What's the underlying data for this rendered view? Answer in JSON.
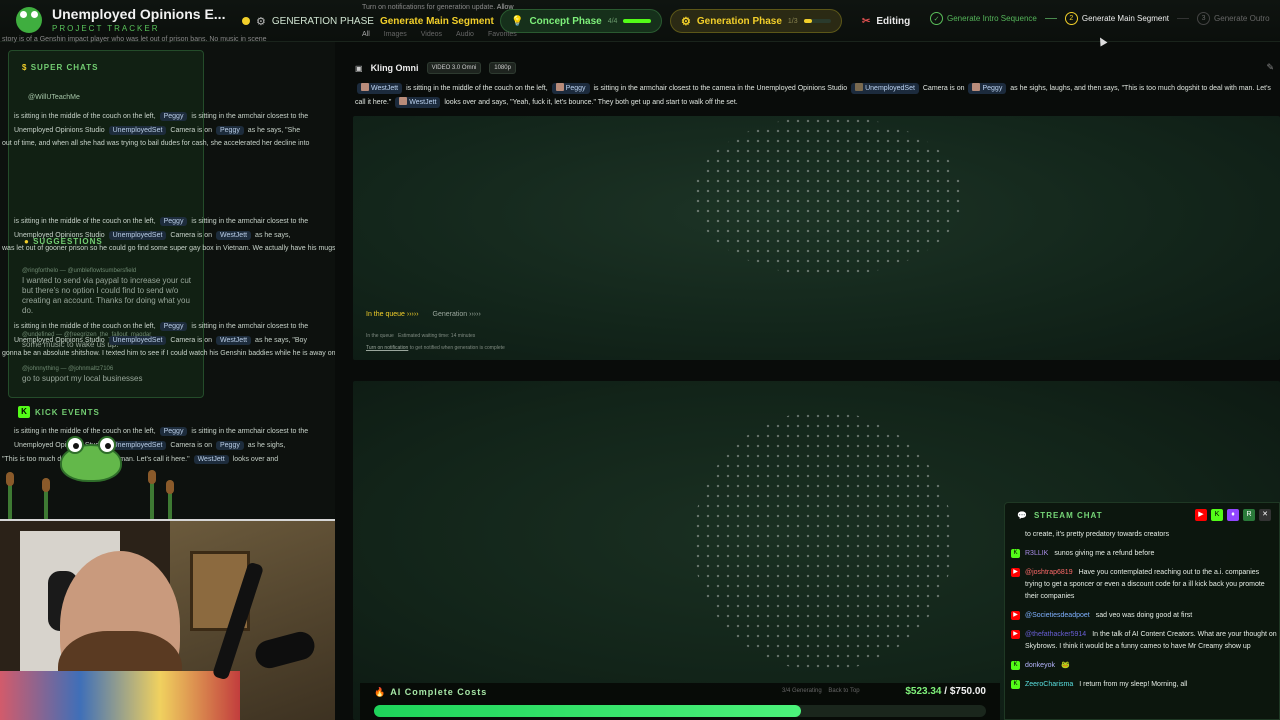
{
  "brand": {
    "title": "Unemployed Opinions E...",
    "subtitle": "PROJECT TRACKER"
  },
  "topbar": {
    "generation_label": "GENERATION PHASE",
    "generation_segment": "Generate Main Segment",
    "concept_label": "Concept Phase",
    "concept_count": "4/4",
    "concept_progress": 1.0,
    "gen_phase_label": "Generation Phase",
    "gen_phase_count": "1/3",
    "gen_phase_progress": 0.3,
    "editing_label": "Editing",
    "steps": [
      {
        "num": "✓",
        "label": "Generate Intro Sequence",
        "state": "done"
      },
      {
        "num": "2",
        "label": "Generate Main Segment",
        "state": "active"
      },
      {
        "num": "3",
        "label": "Generate Outro",
        "state": "todo"
      }
    ],
    "notification": "Turn on notifications for generation update.",
    "notification_allow": "Allow",
    "tabs": [
      "All",
      "Images",
      "Videos",
      "Audio",
      "Favorites"
    ]
  },
  "left": {
    "top_snippet": "story is of a Genshin impact player who was let out of prison bans.  No music in scene",
    "super_chats_title": "SUPER CHATS",
    "super_chat_user": "@WillUTeachMe",
    "prompt_rows": [
      {
        "a": "is sitting in the middle of the couch on the left,",
        "b": "Peggy",
        "c": "is sitting in the armchair closest to the"
      },
      {
        "a": "Unemployed Opinions Studio",
        "b": "UnemployedSet",
        "c": "Camera is on",
        "d": "Peggy",
        "e": "as he says, \"She"
      },
      {
        "a": "out of time, and when all she had was trying to bail dudes for cash, she accelerated her decline into"
      }
    ],
    "suggestions_title": "SUGGESTIONS",
    "suggestions": [
      {
        "user": "@ringforthelo — @umbleflowtsumbersfield",
        "text": "I wanted to send via paypal to increase your cut but there's no option I could find to send w/o creating an account. Thanks for doing what you do."
      },
      {
        "user": "@undefined — @freegrizen_the_fallout_magdar",
        "text": "some music to wake us up!"
      },
      {
        "user": "@johnnything — @johnmaltz7106",
        "text": "go to support my local businesses"
      }
    ],
    "prompt_rows_2": [
      {
        "a": "is sitting in the middle of the couch on the left,",
        "b": "Peggy",
        "c": "is sitting in the armchair closest to the"
      },
      {
        "a": "Unemployed Opinions Studio",
        "b": "UnemployedSet",
        "c": "Camera is on",
        "d": "WestJett",
        "e": "as he says,"
      },
      {
        "a": "was let out of gooner prison so he could go find some super gay box in Vietnam. We actually have his mugshot.\""
      }
    ],
    "prompt_rows_3": [
      {
        "a": "is sitting in the middle of the couch on the left,",
        "b": "Peggy",
        "c": "is sitting in the armchair closest to the"
      },
      {
        "a": "Unemployed Opinions Studio",
        "b": "UnemployedSet",
        "c": "Camera is on",
        "d": "WestJett",
        "e": "as he says, \"Boy"
      },
      {
        "a": "gonna be an absolute shitshow. I texted him to see if I could watch his Genshin baddies while he is away on"
      }
    ],
    "kick_events_title": "KICK EVENTS",
    "prompt_rows_4": [
      {
        "a": "is sitting in the middle of the couch on the left,",
        "b": "Peggy",
        "c": "is sitting in the armchair closest to the"
      },
      {
        "a": "Unemployed Opinions Studio",
        "b": "UnemployedSet",
        "c": "Camera is on",
        "d": "Peggy",
        "e": "as he sighs,"
      },
      {
        "a": "\"This is too much dogshit to deal with man. Let's call it here.\"",
        "b": "WestJett",
        "c": "looks over and"
      }
    ]
  },
  "job": {
    "title": "Kling Omni",
    "model_tag": "VIDEO 3.0 Omni",
    "res_tag": "1080p",
    "prompt": {
      "p1_name": "WestJett",
      "p1": "is sitting in the middle of the couch on the left,",
      "p2_name": "Peggy",
      "p2": "is sitting in the armchair closest to the camera in the Unemployed Opinions Studio",
      "p3_name": "UnemployedSet",
      "p3": "Camera is on",
      "p4_name": "Peggy",
      "p4": "as he sighs, laughs, and then says, \"This is too much dogshit to deal with man. Let's call it here.\"",
      "p5_name": "WestJett",
      "p5": "looks over and says, \"Yeah, fuck it, let's bounce.\" They both get up and start to walk off the set."
    },
    "queue_status": "In the queue",
    "generation_status": "Generation",
    "queue_line1a": "In the queue",
    "queue_line1b": "Estimated waiting time: 14 minutes",
    "queue_link": "Turn on notification",
    "queue_line2": "to get notified when generation is complete"
  },
  "chat": {
    "title": "STREAM CHAT",
    "messages": [
      {
        "platform": "youtube",
        "user": "",
        "text": "to create, it's pretty predatory towards creators"
      },
      {
        "platform": "kick",
        "user": "R3LLIK",
        "text": "sunos giving me a refund before"
      },
      {
        "platform": "youtube",
        "user": "@joshtrap6819",
        "text": "Have you contemplated reaching out to the a.i. companies trying to get a sponcer or even a discount code for a ill kick back you promote their companies"
      },
      {
        "platform": "youtube",
        "user": "@Societiesdeadpoet",
        "text": "sad veo was doing good at first"
      },
      {
        "platform": "youtube",
        "user": "@thefathacker5914",
        "text": "In the talk of AI Content Creators. What are your thought on Skybrows. I think it would be a funny cameo to have Mr Creamy show up"
      },
      {
        "platform": "kick",
        "user": "donkeyok",
        "text": ""
      },
      {
        "platform": "kick",
        "user": "ZeeroCharisma",
        "text": "I return from my sleep! Morning, all"
      }
    ]
  },
  "costs": {
    "label": "AI Complete Costs",
    "meta1": "3/4 Generating",
    "meta2": "Back to Top",
    "spent": "$523.34",
    "sep": " / ",
    "budget": "$750.00",
    "progress": 0.698
  },
  "colors": {
    "accent": "#53fc18",
    "youtube": "#ff0000",
    "twitch": "#9146ff",
    "gold": "#f2cf2a"
  }
}
